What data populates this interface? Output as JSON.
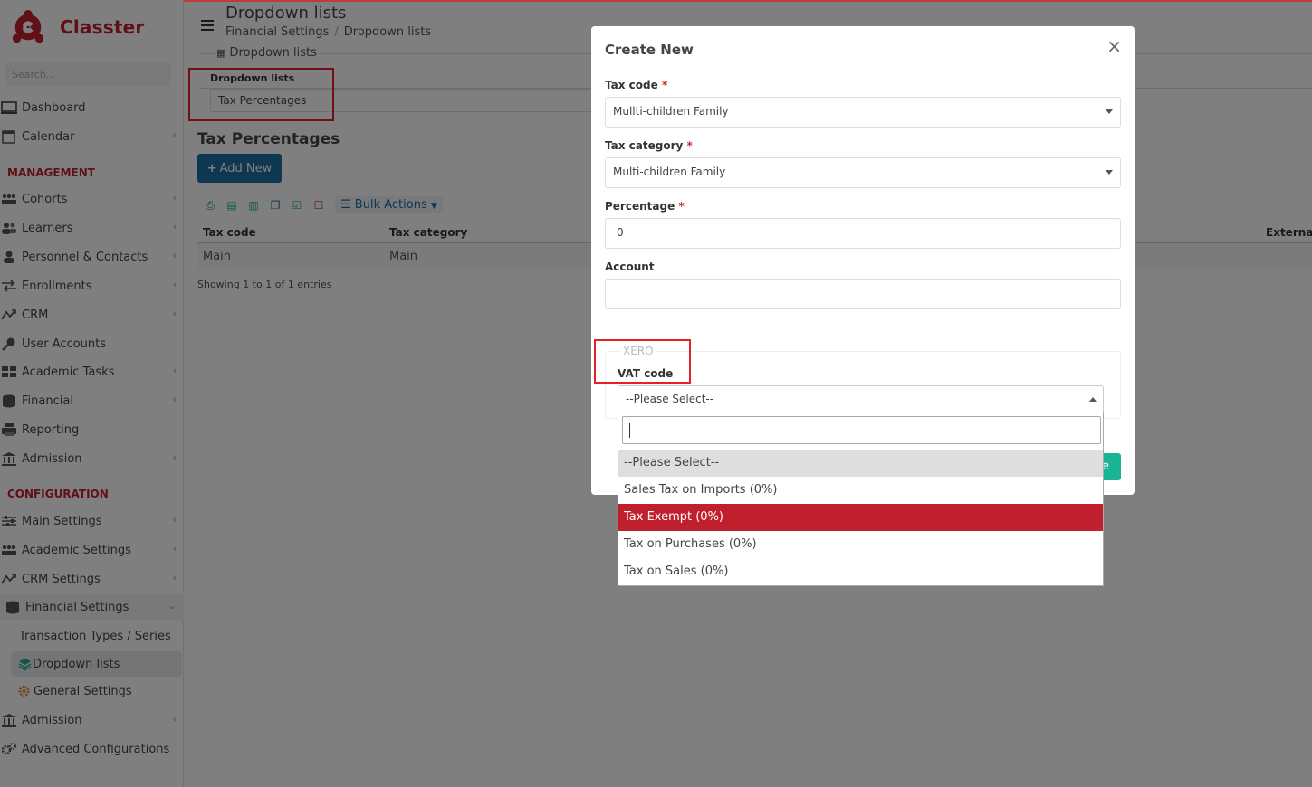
{
  "app": {
    "name": "Classter"
  },
  "sidebar": {
    "search_placeholder": "Search...",
    "items_top": [
      {
        "label": "Dashboard",
        "icon": "monitor-icon"
      },
      {
        "label": "Calendar",
        "icon": "calendar-icon"
      }
    ],
    "section_management": "MANAGEMENT",
    "items_management": [
      {
        "label": "Cohorts",
        "icon": "cohorts-icon"
      },
      {
        "label": "Learners",
        "icon": "learners-icon"
      },
      {
        "label": "Personnel & Contacts",
        "icon": "person-icon"
      },
      {
        "label": "Enrollments",
        "icon": "exchange-icon"
      },
      {
        "label": "CRM",
        "icon": "crm-icon"
      },
      {
        "label": "User Accounts",
        "icon": "key-icon"
      },
      {
        "label": "Academic Tasks",
        "icon": "grid-icon"
      },
      {
        "label": "Financial",
        "icon": "coins-icon"
      },
      {
        "label": "Reporting",
        "icon": "printer-icon"
      },
      {
        "label": "Admission",
        "icon": "bank-icon"
      }
    ],
    "section_configuration": "CONFIGURATION",
    "items_configuration": [
      {
        "label": "Main Settings",
        "icon": "sliders-icon"
      },
      {
        "label": "Academic Settings",
        "icon": "cohorts-icon"
      },
      {
        "label": "CRM Settings",
        "icon": "crm-icon"
      },
      {
        "label": "Financial Settings",
        "icon": "coins-icon"
      },
      {
        "label": "Transaction Types / Series"
      },
      {
        "label": "Dropdown lists",
        "icon": "layers-icon"
      },
      {
        "label": "General Settings",
        "icon": "gears-icon"
      },
      {
        "label": "Admission",
        "icon": "bank-icon"
      },
      {
        "label": "Advanced Configurations",
        "icon": "gears-icon"
      }
    ]
  },
  "header": {
    "title": "Dropdown lists",
    "breadcrumb": [
      "Financial Settings",
      "Dropdown lists"
    ],
    "tab": "Dropdown lists"
  },
  "panel": {
    "label": "Dropdown lists",
    "value": "Tax Percentages"
  },
  "section": {
    "title": "Tax Percentages",
    "add_button": "Add New",
    "bulk_actions": "Bulk Actions"
  },
  "table": {
    "columns": [
      "Tax code",
      "Tax category",
      "External c"
    ],
    "rows": [
      [
        "Main",
        "Main"
      ]
    ],
    "showing": "Showing 1 to 1 of 1 entries"
  },
  "modal": {
    "title": "Create New",
    "close": "×",
    "fields": {
      "tax_code": {
        "label": "Tax code",
        "value": "Mullti-children Family"
      },
      "tax_category": {
        "label": "Tax category",
        "value": "Multi-children Family"
      },
      "percentage": {
        "label": "Percentage",
        "value": "0"
      },
      "account": {
        "label": "Account",
        "value": ""
      }
    },
    "xero_legend": "XERO",
    "vat_label": "VAT code",
    "vat_value": "--Please Select--",
    "save_partial": "e",
    "required_mark": "*"
  },
  "dropdown": {
    "options": [
      "--Please Select--",
      "Sales Tax on Imports (0%)",
      "Tax Exempt (0%)",
      "Tax on Purchases (0%)",
      "Tax on Sales (0%)"
    ],
    "hovered_index": 0,
    "selected_index": 2
  },
  "colors": {
    "brand": "#c0202d",
    "primary": "#1c6ea4",
    "success": "#1ab394",
    "highlight_box": "#e32127"
  }
}
